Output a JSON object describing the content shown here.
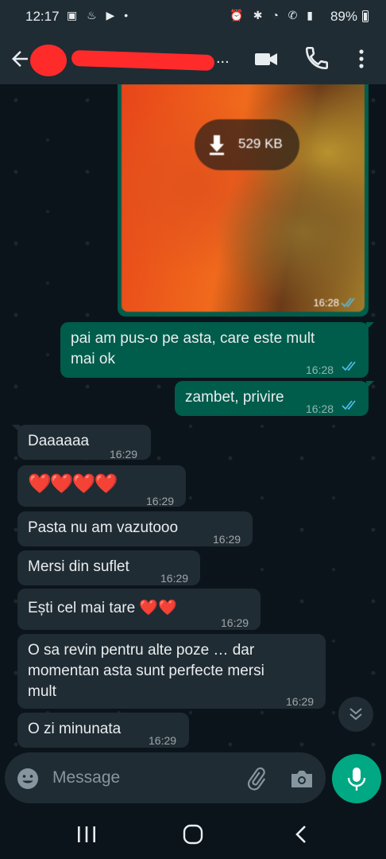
{
  "status_bar": {
    "time": "12:17",
    "battery": "89%"
  },
  "header": {
    "contact_name": "",
    "overflow": "..."
  },
  "image_message": {
    "download_size": "529 KB",
    "time": "16:28"
  },
  "messages": [
    {
      "dir": "out",
      "text": [
        "pai am pus-o pe asta, care este mult",
        "mai ok"
      ],
      "time": "16:28",
      "status": "read"
    },
    {
      "dir": "out",
      "text": [
        "zambet, privire"
      ],
      "time": "16:28",
      "status": "read"
    },
    {
      "dir": "in",
      "text": [
        "Daaaaaa"
      ],
      "time": "16:29"
    },
    {
      "dir": "in",
      "text": [
        "❤️❤️❤️❤️"
      ],
      "time": "16:29"
    },
    {
      "dir": "in",
      "text": [
        "Pasta nu am vazutooo"
      ],
      "time": "16:29"
    },
    {
      "dir": "in",
      "text": [
        "Mersi din suflet"
      ],
      "time": "16:29"
    },
    {
      "dir": "in",
      "text": [
        "Ești cel mai tare ❤️❤️"
      ],
      "time": "16:29"
    },
    {
      "dir": "in",
      "text": [
        "O sa revin pentru alte poze … dar",
        "momentan asta sunt perfecte mersi",
        "mult"
      ],
      "time": "16:29"
    },
    {
      "dir": "in",
      "text": [
        "O zi minunata"
      ],
      "time": "16:29"
    }
  ],
  "composer": {
    "placeholder": "Message"
  },
  "colors": {
    "outgoing": "#005c4b",
    "incoming": "#202c33",
    "accent": "#00a884",
    "read_ticks": "#53bdeb"
  },
  "icons": {
    "back": "arrow-left-icon",
    "video": "video-camera-icon",
    "call": "phone-icon",
    "menu": "more-vertical-icon",
    "download": "download-arrow-icon",
    "emoji": "emoji-icon",
    "attach": "paperclip-icon",
    "camera": "camera-icon",
    "mic": "microphone-icon",
    "scroll": "double-chevron-down-icon"
  }
}
